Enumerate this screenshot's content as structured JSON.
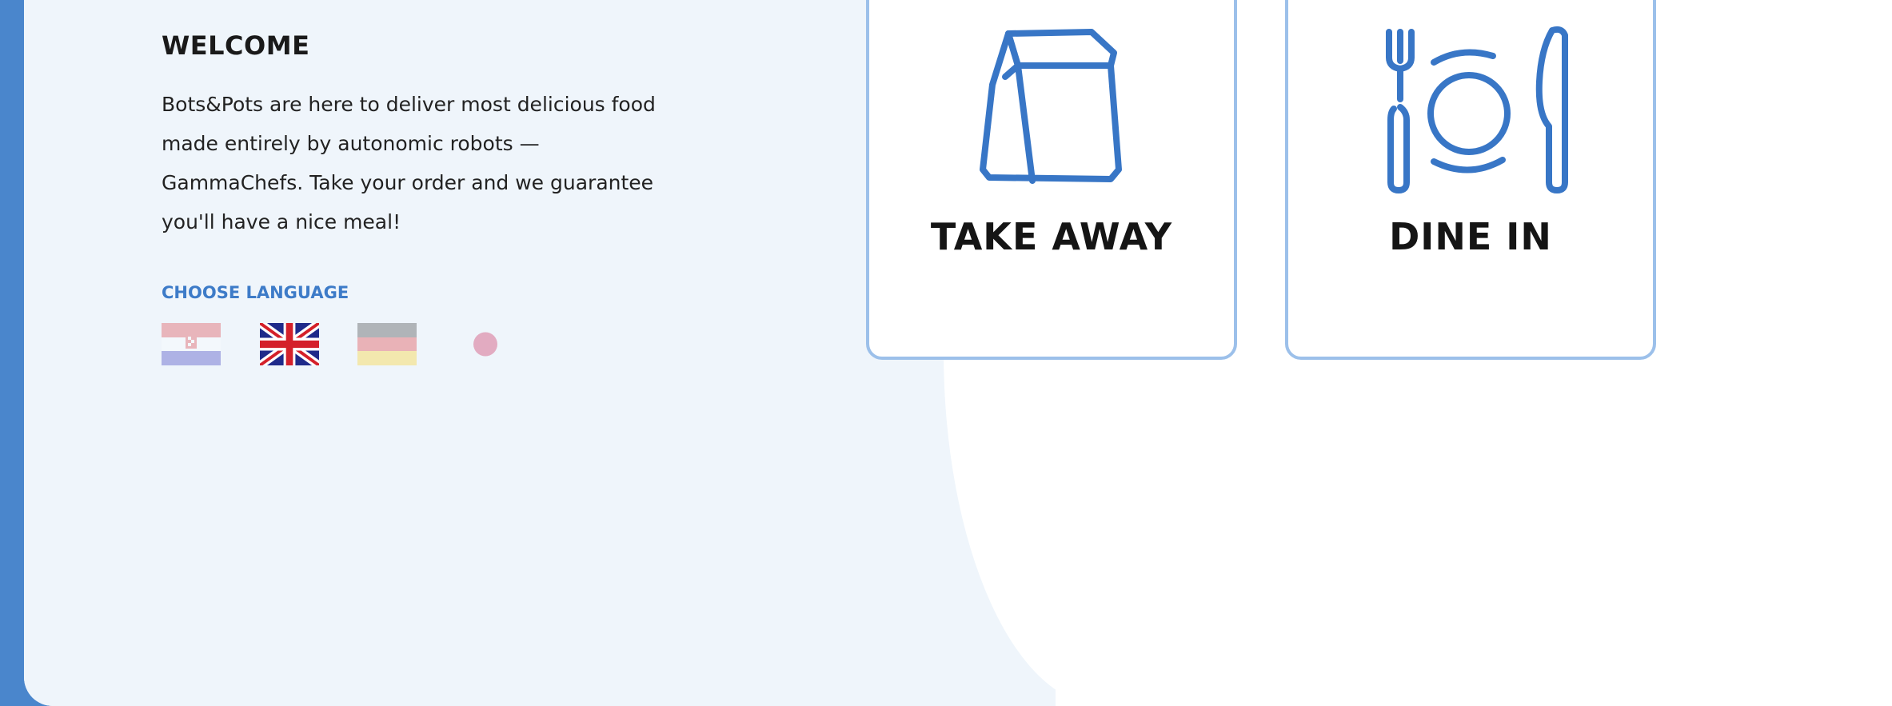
{
  "welcome": {
    "title": "WELCOME",
    "text": "Bots&Pots are here to deliver most delicious food made entirely by autonomic robots — GammaChefs. Take your order and we guarantee you'll have a nice meal!"
  },
  "language": {
    "label": "CHOOSE LANGUAGE",
    "flags": [
      {
        "icon": "croatia-flag-icon",
        "selected": false
      },
      {
        "icon": "uk-flag-icon",
        "selected": true
      },
      {
        "icon": "germany-flag-icon",
        "selected": false
      },
      {
        "icon": "japan-flag-icon",
        "selected": false
      }
    ]
  },
  "options": [
    {
      "label": "TAKE AWAY",
      "icon": "paper-bag-icon"
    },
    {
      "label": "DINE IN",
      "icon": "plate-cutlery-icon"
    }
  ],
  "colors": {
    "accent": "#3d7bc8",
    "frame": "#4a86cc",
    "panel": "#eff5fb",
    "card_border": "#9cc0ea"
  }
}
